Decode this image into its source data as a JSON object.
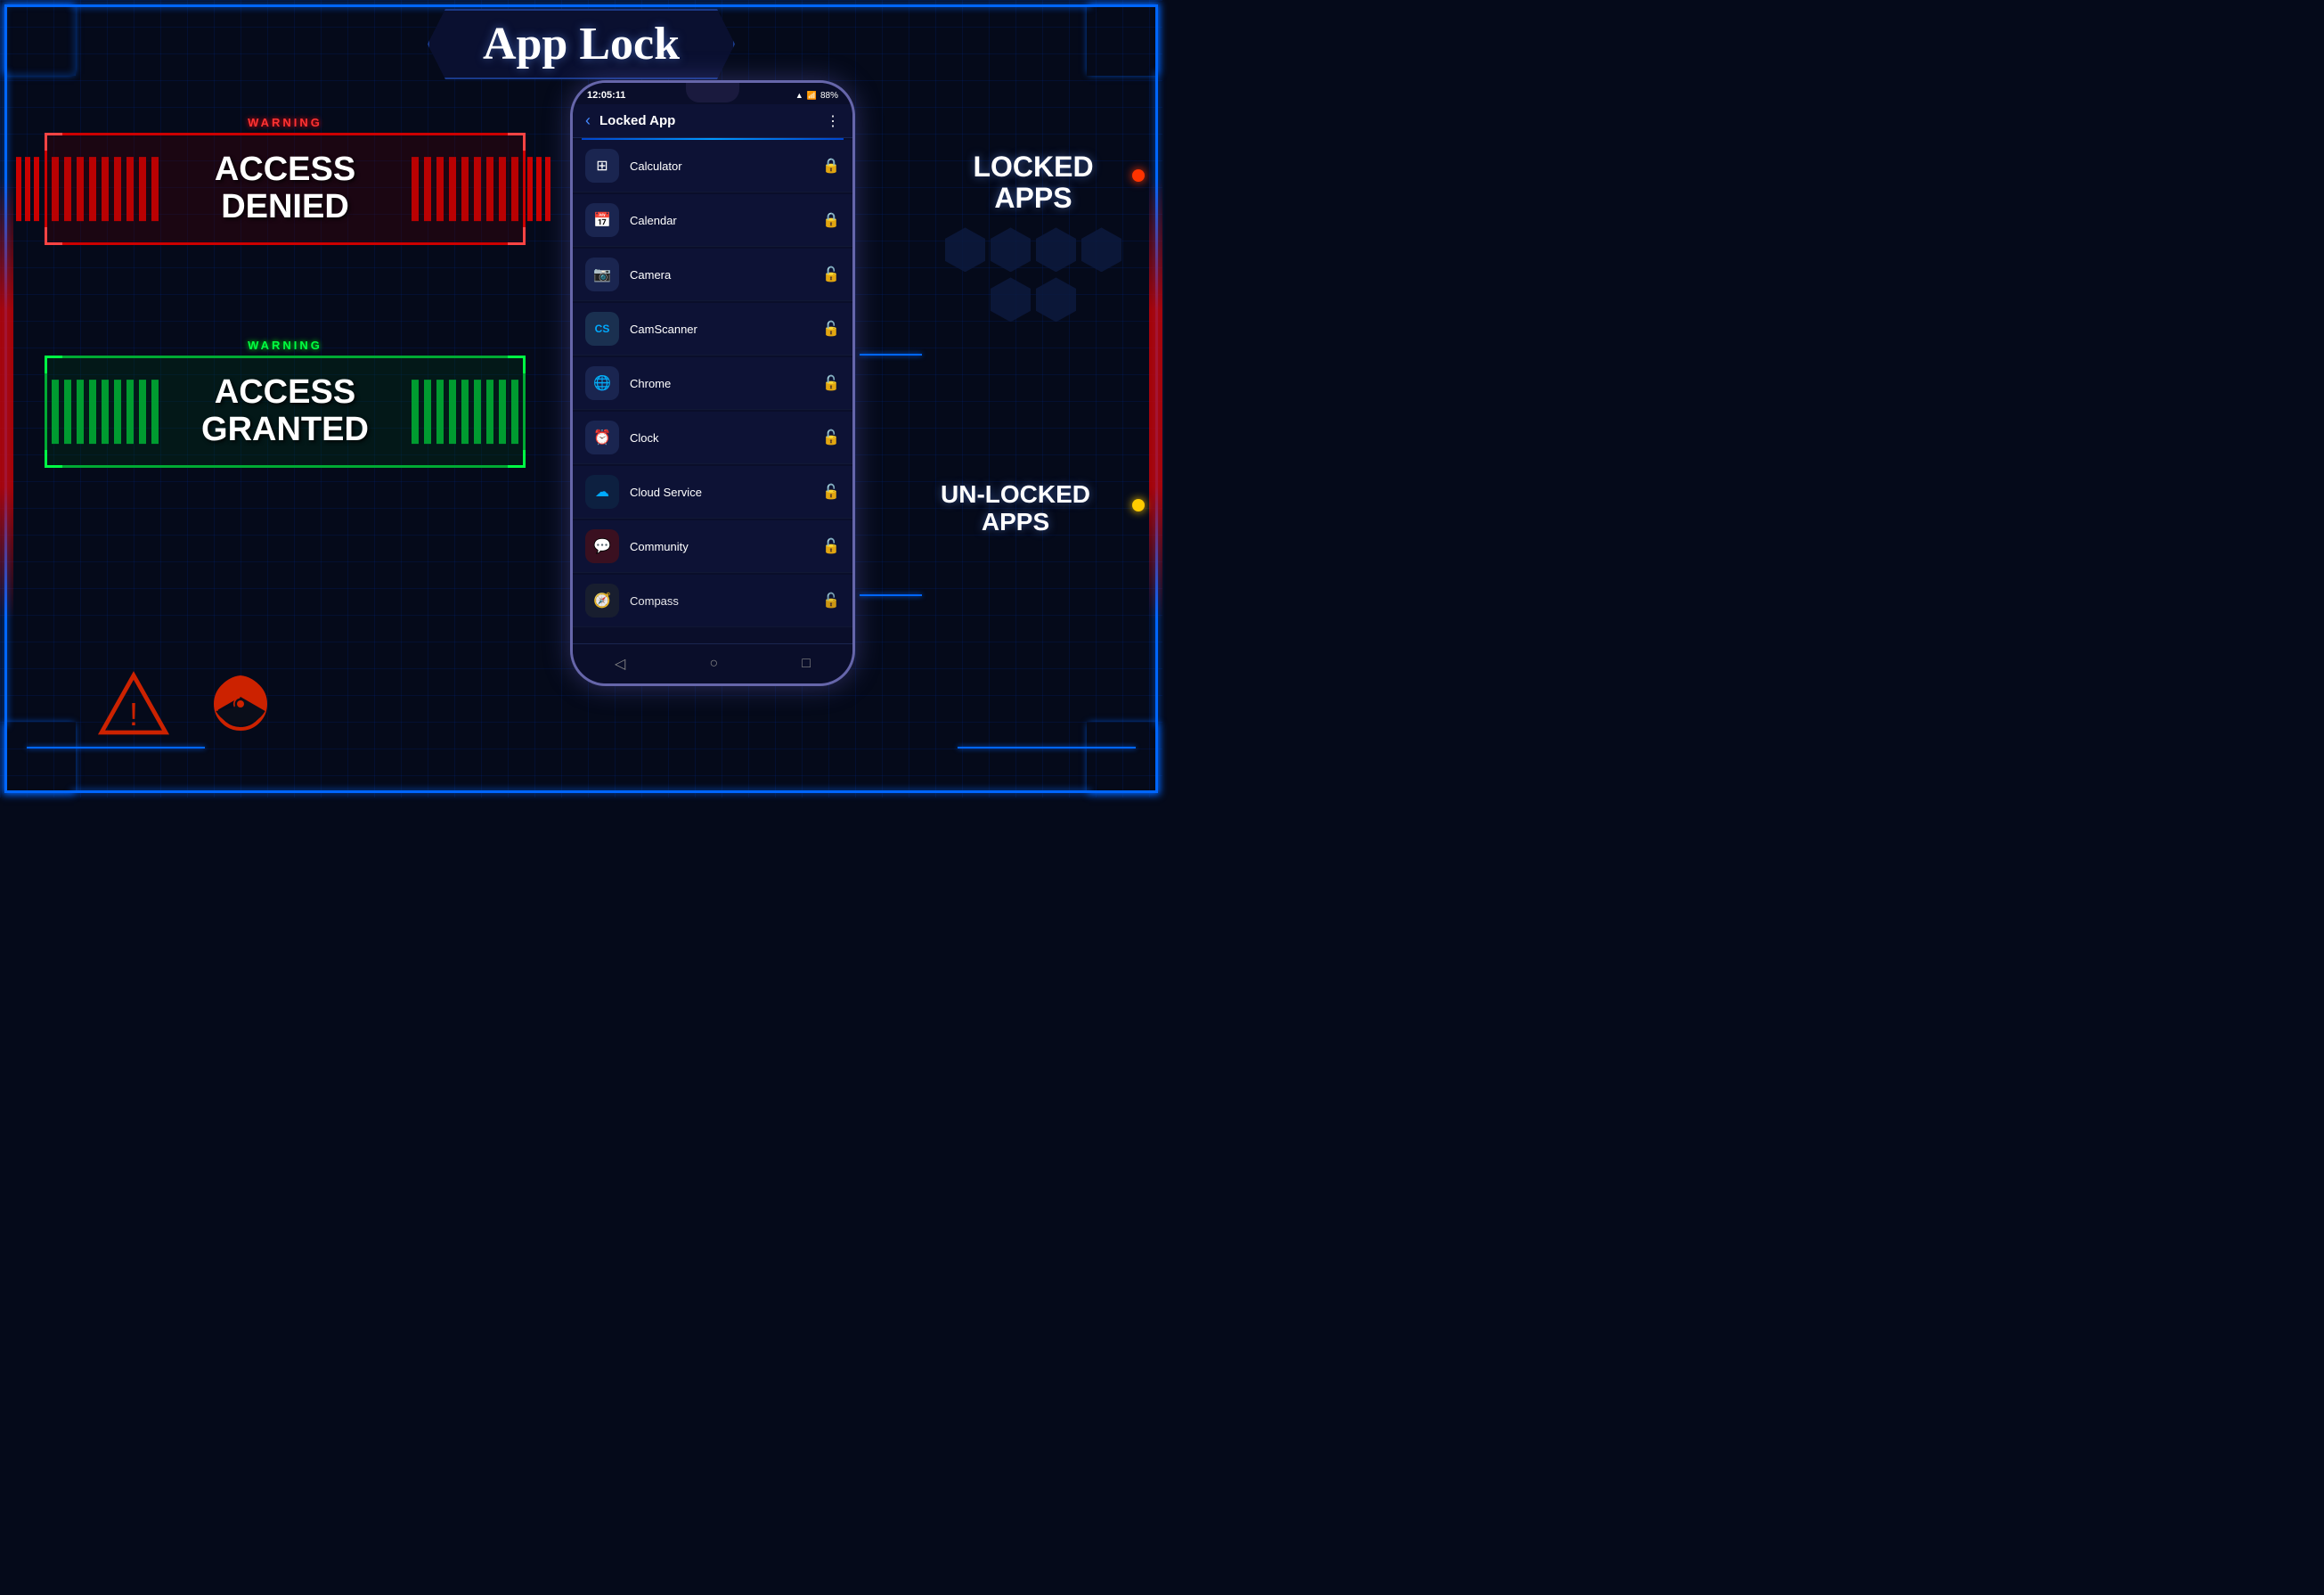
{
  "title": "App Lock",
  "access_denied": {
    "warning": "WARNING",
    "line1": "ACCESS",
    "line2": "DENIED"
  },
  "access_granted": {
    "warning": "WARNING",
    "line1": "ACCESS",
    "line2": "GRANTED"
  },
  "phone": {
    "status_time": "12:05:11",
    "battery": "88%",
    "header_title": "Locked App",
    "back_arrow": "‹",
    "menu_icon": "⋮",
    "apps": [
      {
        "name": "Calculator",
        "icon": "⊞",
        "locked": true,
        "icon_bg": "#1a2550"
      },
      {
        "name": "Calendar",
        "icon": "📅",
        "locked": true,
        "icon_bg": "#1a2550"
      },
      {
        "name": "Camera",
        "icon": "📷",
        "locked": false,
        "icon_bg": "#1a2550"
      },
      {
        "name": "CamScanner",
        "icon": "CS",
        "locked": false,
        "icon_bg": "#1a3050"
      },
      {
        "name": "Chrome",
        "icon": "🌐",
        "locked": false,
        "icon_bg": "#1a2550"
      },
      {
        "name": "Clock",
        "icon": "⏰",
        "locked": false,
        "icon_bg": "#1a2550"
      },
      {
        "name": "Cloud Service",
        "icon": "☁",
        "locked": false,
        "icon_bg": "#1a3050"
      },
      {
        "name": "Community",
        "icon": "💬",
        "locked": false,
        "icon_bg": "#2a1a20"
      },
      {
        "name": "Compass",
        "icon": "🧭",
        "locked": false,
        "icon_bg": "#1a2550"
      }
    ],
    "nav_back": "◁",
    "nav_home": "○",
    "nav_recent": "□"
  },
  "right_panel": {
    "locked_apps_label": "LOCKED\nAPPS",
    "locked_apps_line1": "LOCKED",
    "locked_apps_line2": "APPS",
    "unlocked_apps_line1": "UN-LOCKED",
    "unlocked_apps_line2": "APPS"
  }
}
